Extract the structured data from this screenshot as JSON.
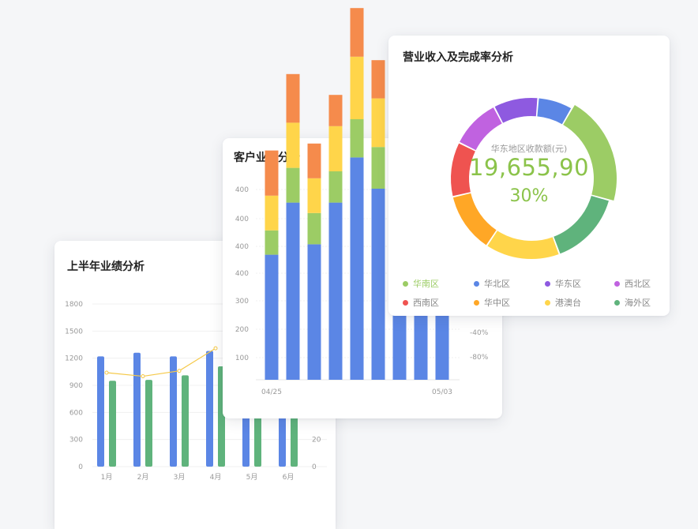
{
  "colors": {
    "blue": "#5b86e5",
    "green": "#5fb37c",
    "yellow": "#f0c94a",
    "stackGreen": "#9ccc65",
    "stackYellow": "#ffd54a",
    "stackOrange": "#f58b4c",
    "line": "#f5c94a",
    "accentGreen": "#8bc34a"
  },
  "card1": {
    "title": "上半年业绩分析",
    "chart_data": {
      "type": "bar",
      "title": "上半年业绩分析",
      "categories": [
        "1月",
        "2月",
        "3月",
        "4月",
        "5月",
        "6月"
      ],
      "ylim": [
        0,
        1800
      ],
      "yticks": [
        "1800",
        "1500",
        "1200",
        "900",
        "600",
        "300",
        "0"
      ],
      "right_ticks": [
        "20",
        "0"
      ],
      "series": [
        {
          "values": [
            1220,
            1260,
            1220,
            1280,
            1250,
            1240
          ]
        },
        {
          "values": [
            950,
            960,
            1010,
            1110,
            1030,
            1060
          ]
        }
      ],
      "line": [
        1040,
        1000,
        1060,
        1310
      ]
    }
  },
  "card2": {
    "title": "客户业绩分析",
    "chart_data": {
      "type": "bar",
      "title": "客户业绩分析",
      "categories": [
        "04/25",
        "",
        "",
        "",
        "",
        "",
        "",
        "",
        "05/03"
      ],
      "ylim": [
        0,
        400
      ],
      "yticks": [
        "400",
        "400",
        "400",
        "400",
        "300",
        "200",
        "100"
      ],
      "right_ticks": [
        "-40%",
        "-80%"
      ],
      "series": [
        {
          "values": [
            180,
            255,
            195,
            255,
            320,
            275,
            240,
            245,
            240
          ]
        },
        {
          "values": [
            35,
            50,
            45,
            45,
            55,
            60,
            0,
            0,
            0
          ]
        },
        {
          "values": [
            50,
            65,
            50,
            65,
            90,
            70,
            0,
            0,
            0
          ]
        },
        {
          "values": [
            65,
            70,
            50,
            45,
            70,
            55,
            0,
            0,
            0
          ]
        }
      ]
    }
  },
  "card3": {
    "title": "营业收入及完成率分析",
    "center_label": "华东地区收款额(元)",
    "center_value": "19,655,90",
    "center_percent": "30%",
    "chart_data": {
      "type": "pie",
      "title": "营业收入及完成率分析",
      "slices": [
        {
          "name": "华南区",
          "value": 21,
          "color": "#9ccc65",
          "highlight": true
        },
        {
          "name": "海外区",
          "value": 15,
          "color": "#5fb37c"
        },
        {
          "name": "港澳台",
          "value": 15,
          "color": "#ffd54a"
        },
        {
          "name": "华中区",
          "value": 12,
          "color": "#ffa726"
        },
        {
          "name": "西南区",
          "value": 11,
          "color": "#ef5350"
        },
        {
          "name": "西北区",
          "value": 10,
          "color": "#c062e0"
        },
        {
          "name": "华东区",
          "value": 9,
          "color": "#8e5ae0"
        },
        {
          "name": "华北区",
          "value": 7,
          "color": "#5b86e5"
        }
      ]
    },
    "legend": [
      {
        "label": "华南区",
        "color": "#9ccc65",
        "active": true
      },
      {
        "label": "华北区",
        "color": "#5b86e5",
        "active": false
      },
      {
        "label": "华东区",
        "color": "#8e5ae0",
        "active": false
      },
      {
        "label": "西北区",
        "color": "#c062e0",
        "active": false
      },
      {
        "label": "西南区",
        "color": "#ef5350",
        "active": false
      },
      {
        "label": "华中区",
        "color": "#ffa726",
        "active": false
      },
      {
        "label": "港澳台",
        "color": "#ffd54a",
        "active": false
      },
      {
        "label": "海外区",
        "color": "#5fb37c",
        "active": false
      }
    ]
  }
}
